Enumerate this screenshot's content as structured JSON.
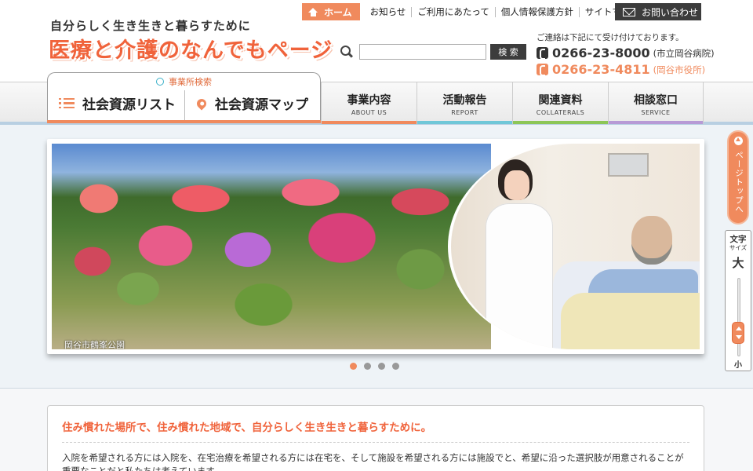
{
  "header": {
    "tagline": "自分らしく生き生きと暮らすために",
    "logo": "医療と介護のなんでもページ",
    "topnav": {
      "home": "ホーム",
      "links": [
        "お知らせ",
        "ご利用にあたって",
        "個人情報保護方針",
        "サイトマップ"
      ],
      "contact": "お問い合わせ"
    },
    "search": {
      "placeholder": "",
      "button": "検 索"
    },
    "contact": {
      "note": "ご連絡は下記にて受け付けております。",
      "phones": [
        {
          "number": "0266-23-8000",
          "org": "(市立岡谷病院)",
          "color": "#333333",
          "icon_color": "#333333"
        },
        {
          "number": "0266-23-4811",
          "org": "(岡谷市役所)",
          "color": "#f08a5d",
          "icon_color": "#f08a5d"
        }
      ]
    }
  },
  "nav": {
    "facility_search": "事業所検索",
    "resource_list": "社会資源リスト",
    "resource_map": "社会資源マップ",
    "items": [
      {
        "jp": "事業内容",
        "en": "ABOUT US",
        "color": "#f08a5d"
      },
      {
        "jp": "活動報告",
        "en": "REPORT",
        "color": "#6fc7d8"
      },
      {
        "jp": "関連資料",
        "en": "COLLATERALS",
        "color": "#8cc657"
      },
      {
        "jp": "相談窓口",
        "en": "SERVICE",
        "color": "#b79ad6"
      }
    ]
  },
  "slider": {
    "caption": "岡谷市鶴峯公園",
    "dots": 4,
    "active_dot": 0
  },
  "side": {
    "pagetop": "ページトップへ",
    "fontsize_title": "文字",
    "fontsize_sub": "サイズ",
    "large": "大",
    "small": "小"
  },
  "intro": {
    "heading": "住み慣れた場所で、住み慣れた地域で、自分らしく生き生きと暮らすために。",
    "body": "入院を希望される方には入院を、在宅治療を希望される方には在宅を、そして施設を希望される方には施設でと、希望に沿った選択肢が用意されることが重要なことだと私たちは考えています。"
  },
  "colors": {
    "accent": "#f08a5d",
    "dark": "#3c3c3c"
  }
}
